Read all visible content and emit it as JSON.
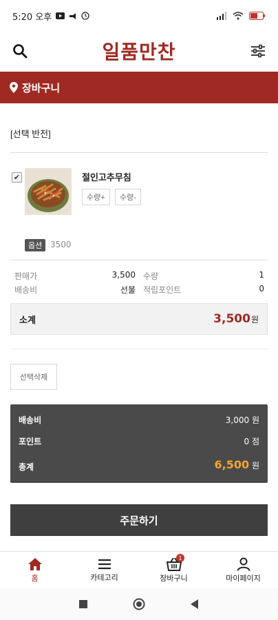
{
  "status_bar": {
    "time": "5:20 오후",
    "battery": "51"
  },
  "header": {
    "brand": "일품만찬",
    "search_icon": "search-icon",
    "filter_icon": "sliders-icon"
  },
  "title_bar": {
    "label": "장바구니",
    "icon": "location-pin-icon"
  },
  "cart": {
    "select_toggle_label": "[선택 반전]",
    "item": {
      "name": "절인고추무침",
      "checked": true,
      "qty_plus_label": "수량+",
      "qty_minus_label": "수량-",
      "option_tag": "옵션",
      "option_price": "3500"
    },
    "info": {
      "sale_price_label": "판매가",
      "sale_price_value": "3,500",
      "quantity_label": "수량",
      "quantity_value": "1",
      "shipping_label": "배송비",
      "shipping_value": "선불",
      "points_label": "적립포인트",
      "points_value": "0"
    },
    "subtotal": {
      "label": "소계",
      "amount": "3,500",
      "unit": "원"
    },
    "delete_selected_label": "선택삭제"
  },
  "summary": {
    "shipping_label": "배송비",
    "shipping_value": "3,000 원",
    "points_label": "포인트",
    "points_value": "0 점",
    "total_label": "총계",
    "total_value": "6,500",
    "total_unit": "원"
  },
  "order_button_label": "주문하기",
  "bottom_nav": {
    "home": "홈",
    "category": "카테고리",
    "cart": "장바구니",
    "cart_badge": "1",
    "mypage": "마이페이지"
  },
  "colors": {
    "brand": "#a02a23",
    "total_accent": "#f3a433",
    "summary_bg": "#4a4a4a"
  }
}
